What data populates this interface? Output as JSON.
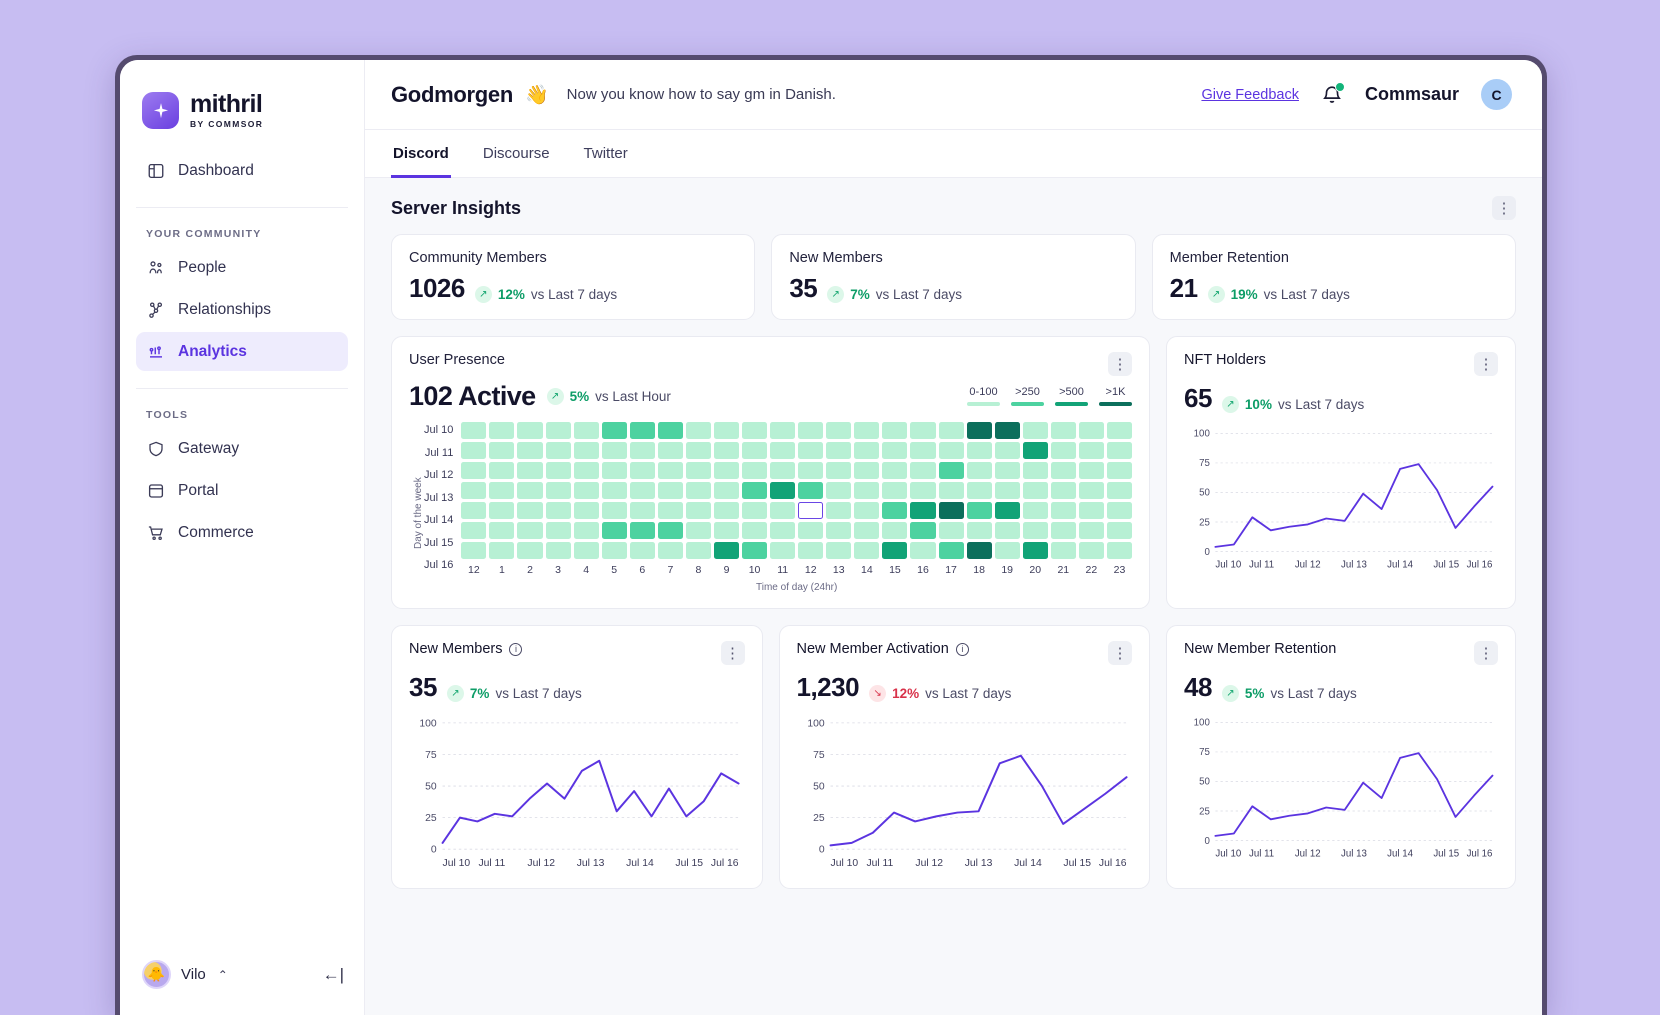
{
  "brand": {
    "name": "mithril",
    "sub": "BY COMMSOR",
    "logo_icon": "sparkle-icon"
  },
  "sidebar": {
    "items": [
      {
        "label": "Dashboard",
        "icon": "layout-icon"
      }
    ],
    "community_heading": "YOUR COMMUNITY",
    "community_items": [
      {
        "label": "People",
        "icon": "people-icon"
      },
      {
        "label": "Relationships",
        "icon": "relationships-icon"
      },
      {
        "label": "Analytics",
        "icon": "bar-chart-icon"
      }
    ],
    "tools_heading": "TOOLS",
    "tools_items": [
      {
        "label": "Gateway",
        "icon": "shield-icon"
      },
      {
        "label": "Portal",
        "icon": "window-icon"
      },
      {
        "label": "Commerce",
        "icon": "cart-icon"
      }
    ],
    "footer": {
      "user": "Vilo",
      "caret": "⌃",
      "collapse_icon": "←|"
    }
  },
  "header": {
    "greeting": "Godmorgen",
    "wave": "👋",
    "subtitle": "Now you know how to say gm in Danish.",
    "feedback": "Give Feedback",
    "user": "Commsaur",
    "avatar_initial": "C"
  },
  "tabs": [
    {
      "label": "Discord",
      "active": true
    },
    {
      "label": "Discourse",
      "active": false
    },
    {
      "label": "Twitter",
      "active": false
    }
  ],
  "section": {
    "title": "Server Insights",
    "kebab": "⋮"
  },
  "stats": [
    {
      "label": "Community Members",
      "value": "1026",
      "pct": "12%",
      "vs": "vs Last 7 days",
      "dir": "up"
    },
    {
      "label": "New Members",
      "value": "35",
      "pct": "7%",
      "vs": "vs Last 7 days",
      "dir": "up"
    },
    {
      "label": "Member Retention",
      "value": "21",
      "pct": "19%",
      "vs": "vs Last 7 days",
      "dir": "up"
    }
  ],
  "presence": {
    "title": "User Presence",
    "value": "102 Active",
    "pct": "5%",
    "vs": "vs Last Hour",
    "dir": "up",
    "legend": [
      {
        "label": "0-100",
        "color": "#b7f0d4"
      },
      {
        "label": ">250",
        "color": "#4dd2a0"
      },
      {
        "label": ">500",
        "color": "#12a377"
      },
      {
        "label": ">1K",
        "color": "#0c6f5c"
      }
    ],
    "y_axis_label": "Day of the week",
    "x_axis_label": "Time of day (24hr)",
    "days": [
      "Jul 10",
      "Jul 11",
      "Jul 12",
      "Jul 13",
      "Jul 14",
      "Jul 15",
      "Jul 16"
    ],
    "hours": [
      "12",
      "1",
      "2",
      "3",
      "4",
      "5",
      "6",
      "7",
      "8",
      "9",
      "10",
      "11",
      "12",
      "13",
      "14",
      "15",
      "16",
      "17",
      "18",
      "19",
      "20",
      "21",
      "22",
      "23"
    ],
    "selected_cell": {
      "row": 4,
      "col": 12
    },
    "values": [
      [
        0,
        0,
        0,
        0,
        0,
        1,
        1,
        1,
        0,
        0,
        0,
        0,
        0,
        0,
        0,
        0,
        0,
        0,
        3,
        3,
        0,
        0,
        0,
        0
      ],
      [
        0,
        0,
        0,
        0,
        0,
        0,
        0,
        0,
        0,
        0,
        0,
        0,
        0,
        0,
        0,
        0,
        0,
        0,
        0,
        0,
        2,
        0,
        0,
        0
      ],
      [
        0,
        0,
        0,
        0,
        0,
        0,
        0,
        0,
        0,
        0,
        0,
        0,
        0,
        0,
        0,
        0,
        0,
        1,
        0,
        0,
        0,
        0,
        0,
        0
      ],
      [
        0,
        0,
        0,
        0,
        0,
        0,
        0,
        0,
        0,
        0,
        1,
        2,
        1,
        0,
        0,
        0,
        0,
        0,
        0,
        0,
        0,
        0,
        0,
        0
      ],
      [
        0,
        0,
        0,
        0,
        0,
        0,
        0,
        0,
        0,
        0,
        0,
        0,
        0,
        0,
        0,
        1,
        2,
        3,
        1,
        2,
        0,
        0,
        0,
        0
      ],
      [
        0,
        0,
        0,
        0,
        0,
        1,
        1,
        1,
        0,
        0,
        0,
        0,
        0,
        0,
        0,
        0,
        1,
        0,
        0,
        0,
        0,
        0,
        0,
        0
      ],
      [
        0,
        0,
        0,
        0,
        0,
        0,
        0,
        0,
        0,
        2,
        1,
        0,
        0,
        0,
        0,
        2,
        0,
        1,
        3,
        0,
        2,
        0,
        0,
        0
      ]
    ]
  },
  "chart_data": [
    {
      "type": "line",
      "title": "NFT Holders",
      "value": "65",
      "pct": "10%",
      "vs": "vs Last 7 days",
      "dir": "up",
      "has_info": false,
      "ylabel": "",
      "xlabel": "",
      "ylim": [
        0,
        100
      ],
      "yticks": [
        0,
        25,
        50,
        75,
        100
      ],
      "x": [
        "Jul 10",
        "Jul 11",
        "Jul 12",
        "Jul 13",
        "Jul 14",
        "Jul 15",
        "Jul 16"
      ],
      "xticks": [
        "Jul 10",
        "Jul 11",
        "Jul 12",
        "Jul 13",
        "Jul 14",
        "Jul 15",
        "Jul 16"
      ],
      "values": [
        4,
        6,
        29,
        18,
        21,
        23,
        28,
        26,
        49,
        36,
        70,
        74,
        52,
        20,
        38,
        55
      ],
      "color": "#5b34e0",
      "grid": true
    },
    {
      "type": "line",
      "title": "New Members",
      "value": "35",
      "pct": "7%",
      "vs": "vs Last 7 days",
      "dir": "up",
      "has_info": true,
      "ylabel": "",
      "xlabel": "",
      "ylim": [
        0,
        100
      ],
      "yticks": [
        0,
        25,
        50,
        75,
        100
      ],
      "x": [
        "Jul 10",
        "Jul 11",
        "Jul 12",
        "Jul 13",
        "Jul 14",
        "Jul 15",
        "Jul 16"
      ],
      "xticks": [
        "Jul 10",
        "Jul 11",
        "Jul 12",
        "Jul 13",
        "Jul 14",
        "Jul 15",
        "Jul 16"
      ],
      "values": [
        5,
        25,
        22,
        28,
        26,
        40,
        52,
        40,
        62,
        70,
        30,
        46,
        26,
        48,
        26,
        38,
        60,
        52
      ],
      "color": "#5b34e0",
      "grid": true
    },
    {
      "type": "line",
      "title": "New Member Activation",
      "value": "1,230",
      "pct": "12%",
      "vs": "vs Last 7 days",
      "dir": "down",
      "has_info": true,
      "ylabel": "",
      "xlabel": "",
      "ylim": [
        0,
        100
      ],
      "yticks": [
        0,
        25,
        50,
        75,
        100
      ],
      "x": [
        "Jul 10",
        "Jul 11",
        "Jul 12",
        "Jul 13",
        "Jul 14",
        "Jul 15",
        "Jul 16"
      ],
      "xticks": [
        "Jul 10",
        "Jul 11",
        "Jul 12",
        "Jul 13",
        "Jul 14",
        "Jul 15",
        "Jul 16"
      ],
      "values": [
        3,
        5,
        13,
        29,
        22,
        26,
        29,
        30,
        68,
        74,
        50,
        20,
        32,
        44,
        57
      ],
      "color": "#5b34e0",
      "grid": true
    },
    {
      "type": "line",
      "title": "New Member Retention",
      "value": "48",
      "pct": "5%",
      "vs": "vs Last 7 days",
      "dir": "up",
      "has_info": false,
      "ylabel": "",
      "xlabel": "",
      "ylim": [
        0,
        100
      ],
      "yticks": [
        0,
        25,
        50,
        75,
        100
      ],
      "x": [
        "Jul 10",
        "Jul 11",
        "Jul 12",
        "Jul 13",
        "Jul 14",
        "Jul 15",
        "Jul 16"
      ],
      "xticks": [
        "Jul 10",
        "Jul 11",
        "Jul 12",
        "Jul 13",
        "Jul 14",
        "Jul 15",
        "Jul 16"
      ],
      "values": [
        4,
        6,
        29,
        18,
        21,
        23,
        28,
        26,
        49,
        36,
        70,
        74,
        52,
        20,
        38,
        55
      ],
      "color": "#5b34e0",
      "grid": true
    }
  ],
  "theme": {
    "accent": "#5b34e0",
    "up": "#0d9d67",
    "down": "#d8324a",
    "page_bg": "#c7bdf2",
    "content_bg": "#f7f8fb"
  }
}
